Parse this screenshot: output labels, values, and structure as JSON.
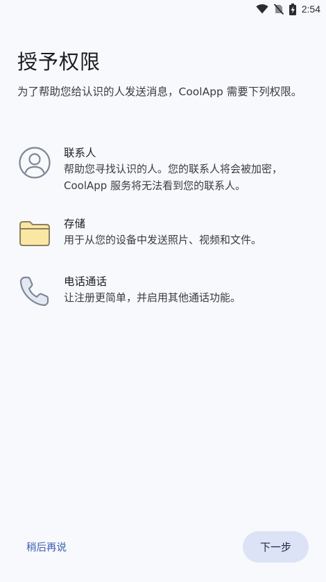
{
  "status_bar": {
    "time": "2:54",
    "icons": [
      "wifi-icon",
      "no-sim-icon",
      "battery-charging-icon"
    ]
  },
  "page": {
    "title": "授予权限",
    "subtitle": "为了帮助您给认识的人发送消息，CoolApp 需要下列权限。"
  },
  "permissions": [
    {
      "icon": "contact-icon",
      "title": "联系人",
      "description": "帮助您寻找认识的人。您的联系人将会被加密，CoolApp 服务将无法看到您的联系人。"
    },
    {
      "icon": "folder-icon",
      "title": "存储",
      "description": "用于从您的设备中发送照片、视频和文件。"
    },
    {
      "icon": "phone-icon",
      "title": "电话通话",
      "description": "让注册更简单，并启用其他通话功能。"
    }
  ],
  "actions": {
    "later_label": "稍后再说",
    "next_label": "下一步"
  },
  "colors": {
    "background": "#f8f9fd",
    "accent": "#3a5fb0",
    "next_button_bg": "#dce3f6",
    "folder_fill": "#fde9a8"
  }
}
